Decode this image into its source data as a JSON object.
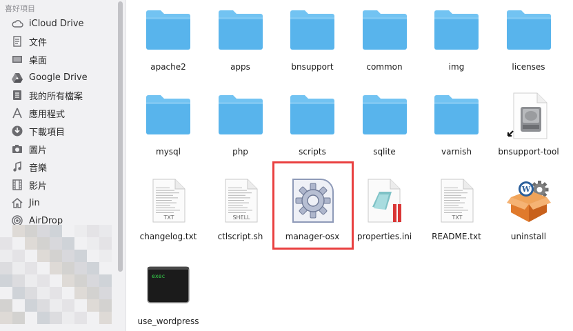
{
  "sidebar": {
    "heading": "喜好項目",
    "items": [
      {
        "label": "iCloud Drive",
        "icon": "cloud-icon"
      },
      {
        "label": "文件",
        "icon": "document-icon"
      },
      {
        "label": "桌面",
        "icon": "desktop-icon"
      },
      {
        "label": "Google Drive",
        "icon": "google-drive-icon"
      },
      {
        "label": "我的所有檔案",
        "icon": "all-files-icon"
      },
      {
        "label": "應用程式",
        "icon": "applications-icon"
      },
      {
        "label": "下載項目",
        "icon": "downloads-icon"
      },
      {
        "label": "圖片",
        "icon": "camera-icon"
      },
      {
        "label": "音樂",
        "icon": "music-icon"
      },
      {
        "label": "影片",
        "icon": "film-icon"
      },
      {
        "label": "Jin",
        "icon": "home-icon"
      },
      {
        "label": "AirDrop",
        "icon": "airdrop-icon"
      }
    ]
  },
  "files": [
    {
      "name": "apache2",
      "kind": "folder"
    },
    {
      "name": "apps",
      "kind": "folder"
    },
    {
      "name": "bnsupport",
      "kind": "folder"
    },
    {
      "name": "common",
      "kind": "folder"
    },
    {
      "name": "img",
      "kind": "folder"
    },
    {
      "name": "licenses",
      "kind": "folder"
    },
    {
      "name": "mysql",
      "kind": "folder"
    },
    {
      "name": "php",
      "kind": "folder"
    },
    {
      "name": "scripts",
      "kind": "folder"
    },
    {
      "name": "sqlite",
      "kind": "folder"
    },
    {
      "name": "varnish",
      "kind": "folder"
    },
    {
      "name": "bnsupport-tool",
      "kind": "disk-alias"
    },
    {
      "name": "changelog.txt",
      "kind": "text",
      "badge": "TXT"
    },
    {
      "name": "ctlscript.sh",
      "kind": "text",
      "badge": "SHELL"
    },
    {
      "name": "manager-osx",
      "kind": "app-gear",
      "selected": true
    },
    {
      "name": "properties.ini",
      "kind": "ini"
    },
    {
      "name": "README.txt",
      "kind": "text",
      "badge": "TXT"
    },
    {
      "name": "uninstall",
      "kind": "package"
    },
    {
      "name": "use_wordpress",
      "kind": "terminal",
      "badge": "exec"
    }
  ],
  "colors": {
    "folder": "#58b4ec",
    "folder_tab": "#72c3f2",
    "sidebar_bg": "#f1f1f3",
    "highlight": "#e94040"
  }
}
